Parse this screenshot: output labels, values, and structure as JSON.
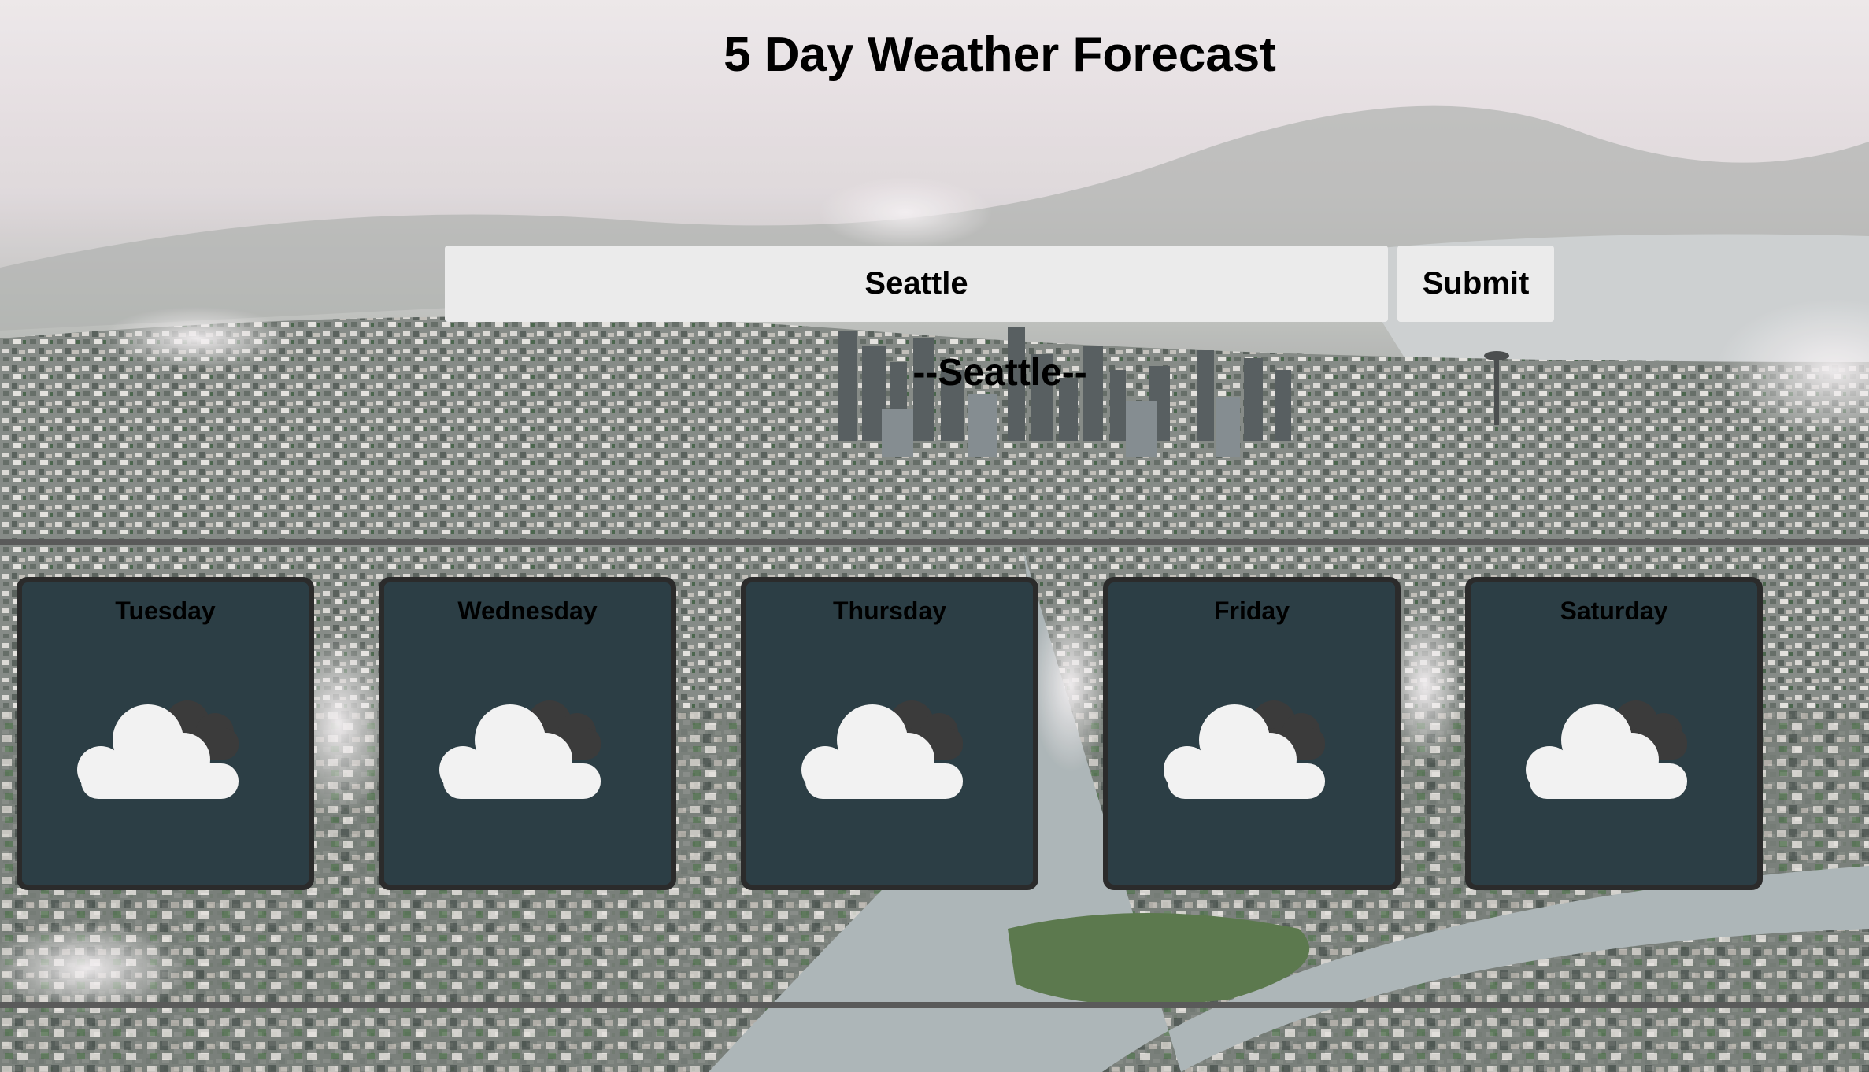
{
  "header": {
    "title": "5 Day Weather Forecast"
  },
  "search": {
    "value": "Seattle",
    "submit_label": "Submit"
  },
  "location": {
    "heading": "--Seattle--"
  },
  "forecast": [
    {
      "day": "Tuesday",
      "icon": "partly-cloudy-icon"
    },
    {
      "day": "Wednesday",
      "icon": "partly-cloudy-icon"
    },
    {
      "day": "Thursday",
      "icon": "partly-cloudy-icon"
    },
    {
      "day": "Friday",
      "icon": "partly-cloudy-icon"
    },
    {
      "day": "Saturday",
      "icon": "partly-cloudy-icon"
    }
  ],
  "colors": {
    "card_background": "#2c3e45",
    "card_border": "#2b2b2b",
    "button_background": "#ebebeb"
  }
}
